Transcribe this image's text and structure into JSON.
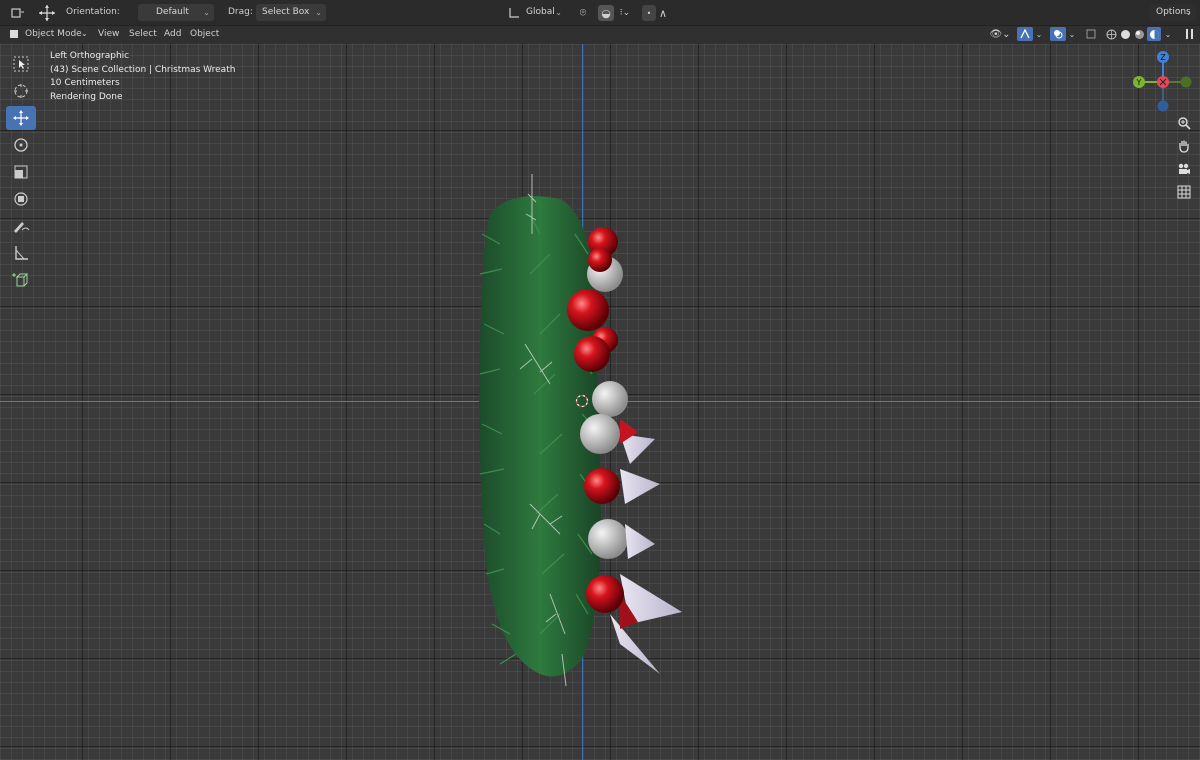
{
  "topbar": {
    "orientation_label": "Orientation:",
    "orientation_value": "Default",
    "drag_label": "Drag:",
    "drag_value": "Select Box",
    "transform_space": "Global",
    "options_label": "Options"
  },
  "header": {
    "mode": "Object Mode",
    "menu": [
      "View",
      "Select",
      "Add",
      "Object"
    ]
  },
  "viewport_info": {
    "view_name": "Left Orthographic",
    "collection": "(43) Scene Collection | Christmas Wreath",
    "scale": "10 Centimeters",
    "status": "Rendering Done"
  },
  "gizmo": {
    "z_label": "Z",
    "y_label": "Y",
    "colors": {
      "x": "#e8485a",
      "y": "#7cb52f",
      "z": "#3f82d6"
    }
  },
  "tools": [
    "select-box-icon",
    "cursor-icon",
    "move-icon",
    "rotate-icon",
    "scale-icon",
    "transform-icon",
    "annotate-icon",
    "measure-icon",
    "add-cube-icon"
  ],
  "nav_icons": [
    "zoom-icon",
    "pan-hand-icon",
    "camera-icon",
    "grid-view-icon"
  ]
}
